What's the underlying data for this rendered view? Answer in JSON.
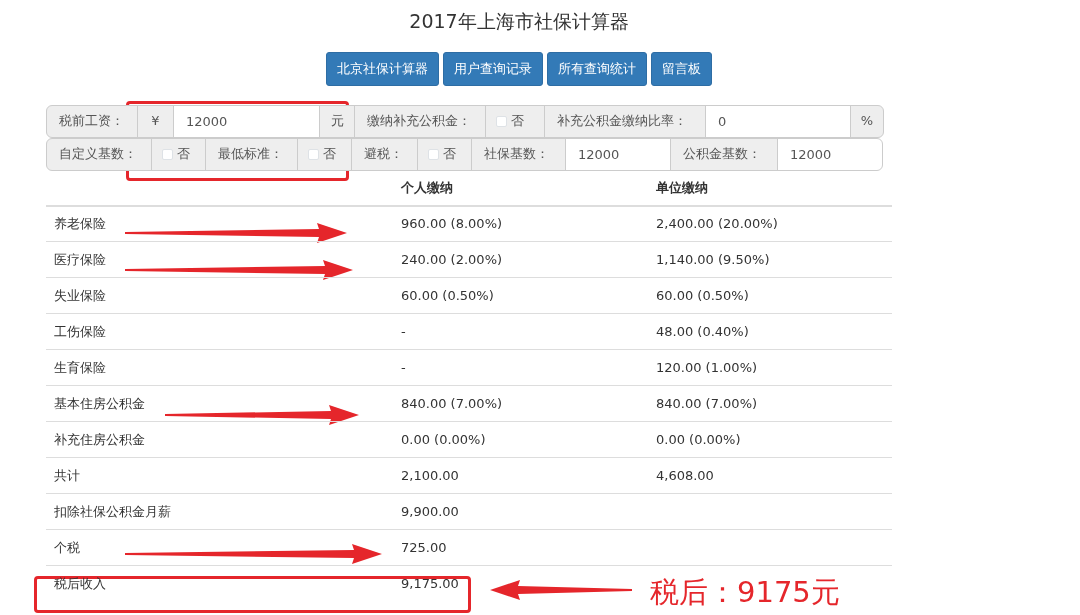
{
  "title": "2017年上海市社保计算器",
  "nav_buttons": [
    "北京社保计算器",
    "用户查询记录",
    "所有查询统计",
    "留言板"
  ],
  "form_rows": [
    [
      {
        "kind": "label",
        "text": "税前工资："
      },
      {
        "kind": "addon",
        "text": "¥"
      },
      {
        "kind": "input",
        "value": "12000"
      },
      {
        "kind": "addon",
        "text": "元"
      },
      {
        "kind": "label",
        "text": "缴纳补充公积金："
      },
      {
        "kind": "checkbox",
        "text": "否",
        "checked": false
      },
      {
        "kind": "label",
        "text": "补充公积金缴纳比率："
      },
      {
        "kind": "input",
        "value": "0"
      },
      {
        "kind": "addon",
        "text": "%"
      }
    ],
    [
      {
        "kind": "label",
        "text": "自定义基数："
      },
      {
        "kind": "checkbox",
        "text": "否",
        "checked": false
      },
      {
        "kind": "label",
        "text": "最低标准："
      },
      {
        "kind": "checkbox",
        "text": "否",
        "checked": false
      },
      {
        "kind": "label",
        "text": "避税："
      },
      {
        "kind": "checkbox",
        "text": "否",
        "checked": false
      },
      {
        "kind": "label",
        "text": "社保基数："
      },
      {
        "kind": "input",
        "value": "12000"
      },
      {
        "kind": "label",
        "text": "公积金基数："
      },
      {
        "kind": "input",
        "value": "12000"
      }
    ]
  ],
  "table": {
    "columns": [
      "个人缴纳",
      "单位缴纳"
    ],
    "rows": [
      {
        "label": "养老保险",
        "personal": "960.00 (8.00%)",
        "company": "2,400.00 (20.00%)"
      },
      {
        "label": "医疗保险",
        "personal": "240.00 (2.00%)",
        "company": "1,140.00 (9.50%)"
      },
      {
        "label": "失业保险",
        "personal": "60.00 (0.50%)",
        "company": "60.00 (0.50%)"
      },
      {
        "label": "工伤保险",
        "personal": "-",
        "company": "48.00 (0.40%)"
      },
      {
        "label": "生育保险",
        "personal": "-",
        "company": "120.00 (1.00%)"
      },
      {
        "label": "基本住房公积金",
        "personal": "840.00 (7.00%)",
        "company": "840.00 (7.00%)"
      },
      {
        "label": "补充住房公积金",
        "personal": "0.00 (0.00%)",
        "company": "0.00 (0.00%)"
      },
      {
        "label": "共计",
        "personal": "2,100.00",
        "company": "4,608.00"
      },
      {
        "label": "扣除社保公积金月薪",
        "personal": "9,900.00"
      },
      {
        "label": "个税",
        "personal": "725.00"
      },
      {
        "label": "税后收入",
        "personal": "9,175.00"
      }
    ]
  },
  "annotation_note": "税后：9175元"
}
